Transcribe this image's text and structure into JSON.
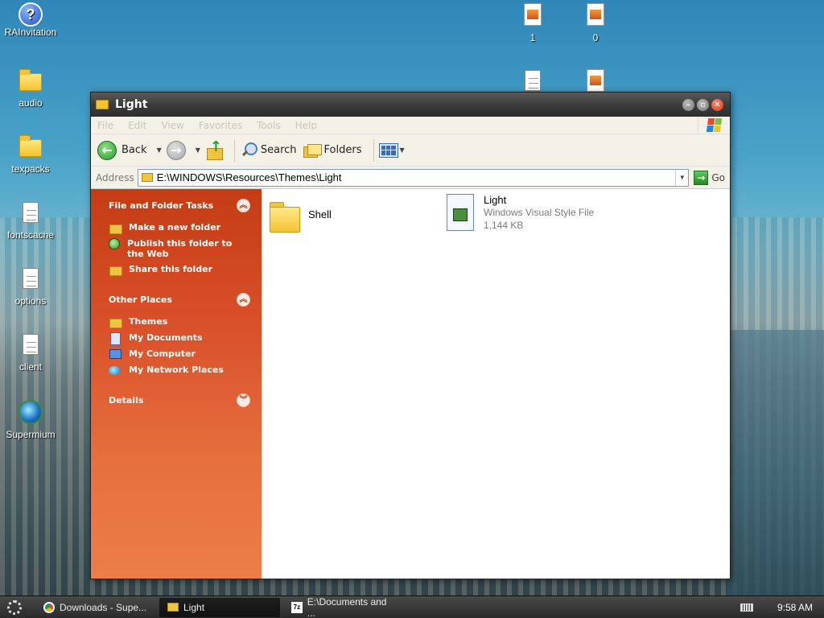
{
  "desktop": {
    "icons": [
      {
        "label": "RAInvitation",
        "icon": "help-icon"
      },
      {
        "label": "audio",
        "icon": "folder-icon"
      },
      {
        "label": "texpacks",
        "icon": "folder-icon"
      },
      {
        "label": "fontscache",
        "icon": "document-icon"
      },
      {
        "label": "options",
        "icon": "document-icon"
      },
      {
        "label": "client",
        "icon": "document-icon"
      },
      {
        "label": "Supermium",
        "icon": "globe-icon"
      },
      {
        "label": "1",
        "icon": "image-file-icon"
      },
      {
        "label": "0",
        "icon": "image-file-icon"
      }
    ]
  },
  "window": {
    "title": "Light",
    "menu": [
      "File",
      "Edit",
      "View",
      "Favorites",
      "Tools",
      "Help"
    ],
    "toolbar": {
      "back": "Back",
      "search": "Search",
      "folders": "Folders"
    },
    "address": {
      "label": "Address",
      "value": "E:\\WINDOWS\\Resources\\Themes\\Light",
      "go": "Go"
    },
    "taskpane": {
      "file_tasks": {
        "title": "File and Folder Tasks",
        "items": [
          "Make a new folder",
          "Publish this folder to the Web",
          "Share this folder"
        ]
      },
      "other_places": {
        "title": "Other Places",
        "items": [
          "Themes",
          "My Documents",
          "My Computer",
          "My Network Places"
        ]
      },
      "details": {
        "title": "Details"
      }
    },
    "files": [
      {
        "name": "Shell",
        "type": "folder"
      },
      {
        "name": "Light",
        "description": "Windows Visual Style File",
        "size": "1,144 KB"
      }
    ]
  },
  "taskbar": {
    "tasks": [
      {
        "label": "Downloads - Supe..."
      },
      {
        "label": "Light"
      },
      {
        "label": "E:\\Documents and ..."
      }
    ],
    "clock": "9:58 AM"
  },
  "colors": {
    "taskpane_top": "#c43c13",
    "taskpane_bottom": "#ec7d48",
    "titlebar": "#3c3c3c",
    "close_button": "#d8341a"
  }
}
